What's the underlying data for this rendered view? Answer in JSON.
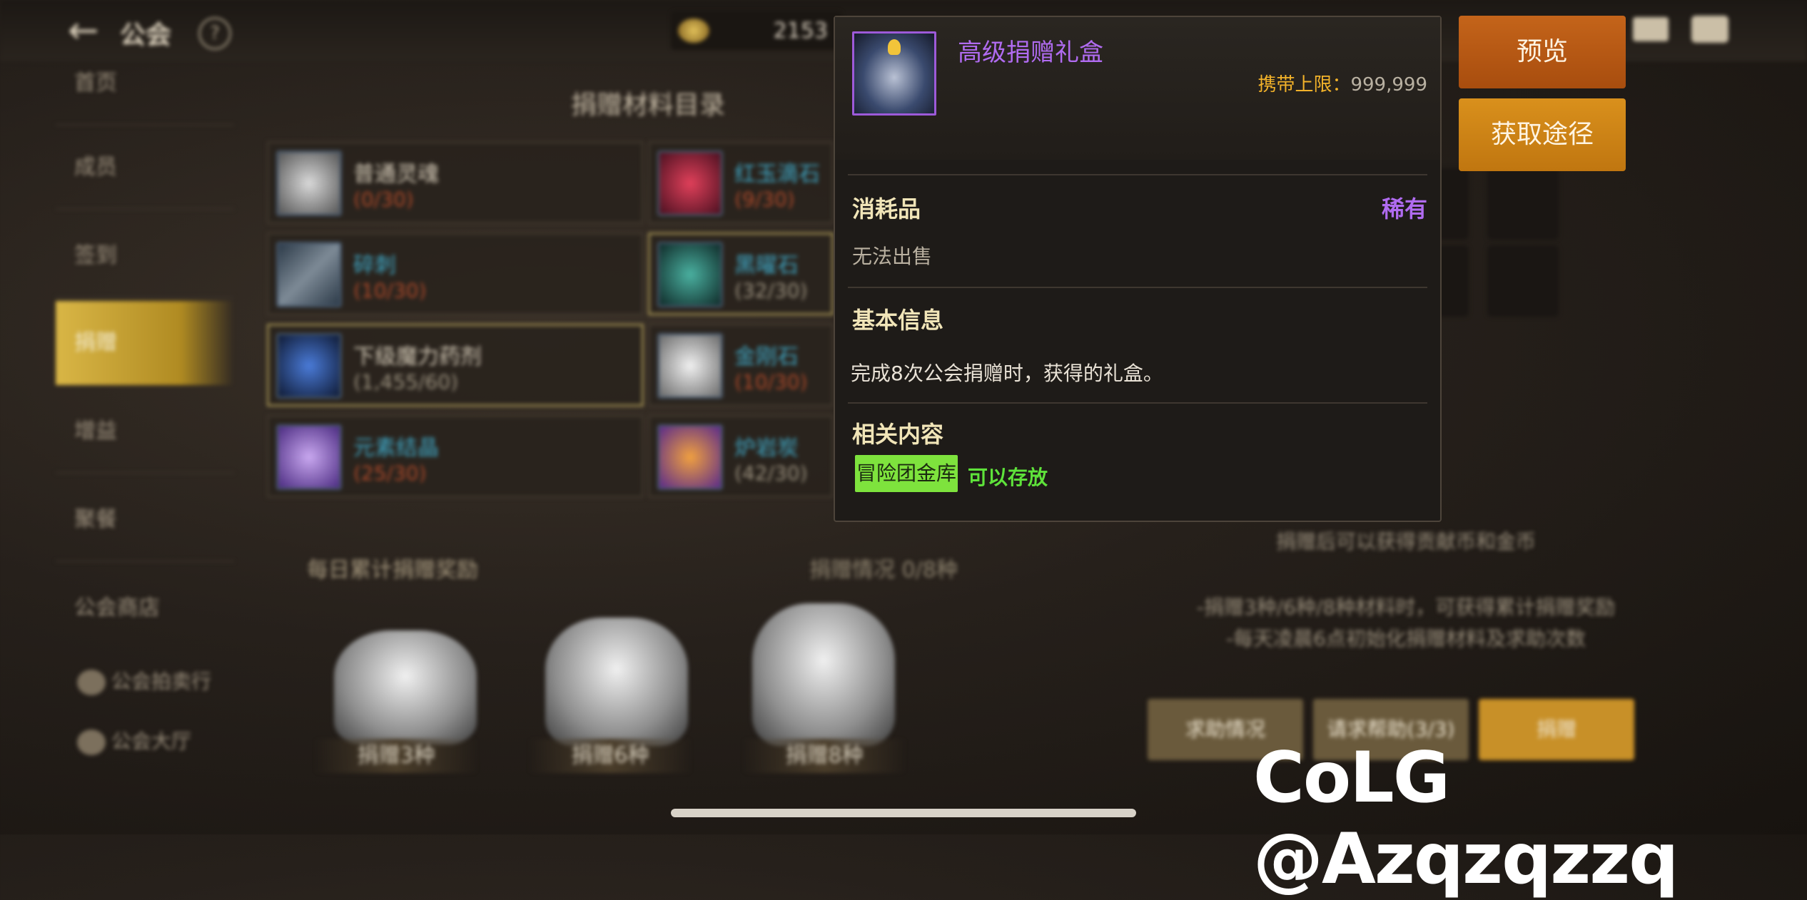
{
  "topbar": {
    "title": "公会",
    "currency_value": "2153"
  },
  "sidebar": {
    "items": [
      {
        "label": "首页"
      },
      {
        "label": "成员"
      },
      {
        "label": "签到"
      },
      {
        "label": "捐赠"
      },
      {
        "label": "增益"
      },
      {
        "label": "聚餐"
      },
      {
        "label": "公会商店"
      }
    ],
    "sub_items": [
      {
        "label": "公会拍卖行"
      },
      {
        "label": "公会大厅"
      }
    ]
  },
  "materials": {
    "title": "捐赠材料目录",
    "items": [
      {
        "name": "普通灵魂",
        "count": "(0/30)"
      },
      {
        "name": "红玉滴石",
        "count": "(9/30)"
      },
      {
        "name": "碎刺",
        "count": "(10/30)"
      },
      {
        "name": "黑曜石",
        "count": "(32/30)"
      },
      {
        "name": "下级魔力药剂",
        "count": "(1,455/60)"
      },
      {
        "name": "金刚石",
        "count": "(10/30)"
      },
      {
        "name": "元素结晶",
        "count": "(25/30)"
      },
      {
        "name": "炉岩炭",
        "count": "(42/30)"
      }
    ]
  },
  "rewards": {
    "title": "每日累计捐赠奖励",
    "status": "捐赠情况 0/8种",
    "tiers": [
      {
        "label": "捐赠3种"
      },
      {
        "label": "捐赠6种"
      },
      {
        "label": "捐赠8种"
      }
    ]
  },
  "right_panel": {
    "note1": "捐赠后可以获得贡献币和金币",
    "note2": "-捐赠3种/6种/8种材料时，可获得累计捐赠奖励",
    "note3": "-每天凌晨6点初始化捐赠材料及求助次数",
    "buttons": [
      {
        "label": "求助情况"
      },
      {
        "label": "请求帮助(3/3)"
      },
      {
        "label": "捐赠"
      }
    ]
  },
  "popup": {
    "item_name": "高级捐赠礼盒",
    "carry_limit_label": "携带上限：",
    "carry_limit_value": "999,999",
    "type": "消耗品",
    "rarity": "稀有",
    "sell_note": "无法出售",
    "basic_info_title": "基本信息",
    "description": "完成8次公会捐赠时，获得的礼盒。",
    "related_title": "相关内容",
    "tag": "冒险团金库",
    "tag_note": "可以存放"
  },
  "actions": {
    "preview": "预览",
    "obtain": "获取途径"
  },
  "watermark": "CoLG @Azqzqzzq"
}
